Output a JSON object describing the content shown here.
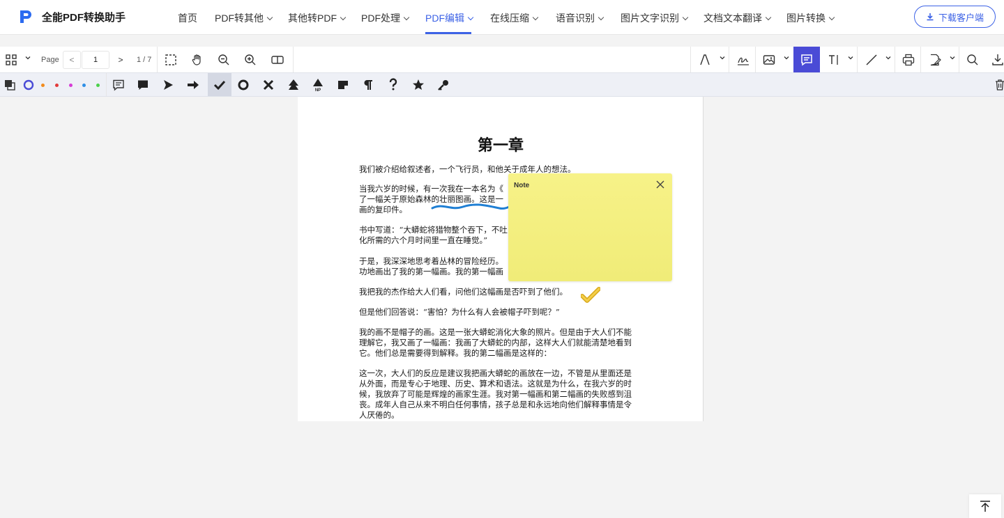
{
  "brand": {
    "name": "全能PDF转换助手"
  },
  "nav": {
    "items": [
      {
        "label": "首页"
      },
      {
        "label": "PDF转其他"
      },
      {
        "label": "其他转PDF"
      },
      {
        "label": "PDF处理"
      },
      {
        "label": "PDF编辑"
      },
      {
        "label": "在线压缩"
      },
      {
        "label": "语音识别"
      },
      {
        "label": "图片文字识别"
      },
      {
        "label": "文档文本翻译"
      },
      {
        "label": "图片转换"
      }
    ],
    "download_label": "下载客户端"
  },
  "toolbar": {
    "page_label": "Page",
    "page_value": "1",
    "page_total": "1 / 7",
    "prev": "<",
    "next": ">"
  },
  "colors": {
    "accent": "#3c62e6",
    "active_tool": "#4a4bd6",
    "note_bg": "#f3ef7e",
    "wave": "#1f7fd4",
    "dots": [
      "#f28b1c",
      "#e23a3a",
      "#d63bd6",
      "#2f8fe6",
      "#4bd14b"
    ]
  },
  "document": {
    "chapter": "第一章",
    "paragraphs": [
      [
        "我们被介绍给叙述者，一个飞行员，和他关于成年人的想法。"
      ],
      [
        "当我六岁的时候，有一次我在一本名为《",
        "了一幅关于原始森林的壮丽图画。这是一",
        "画的复印件。"
      ],
      [
        "书中写道：“大蟒蛇将猎物整个吞下，不吐",
        "化所需的六个月时间里一直在睡觉。”"
      ],
      [
        "于是，我深深地思考着丛林的冒险经历。",
        "功地画出了我的第一幅画。我的第一幅画"
      ],
      [
        "我把我的杰作给大人们看，问他们这幅画是否吓到了他们。"
      ],
      [
        "但是他们回答说：“害怕？为什么有人会被帽子吓到呢？”"
      ],
      [
        "我的画不是帽子的画。这是一张大蟒蛇消化大象的照片。但是由于大人们不能",
        "理解它，我又画了一幅画：我画了大蟒蛇的内部，这样大人们就能清楚地看到",
        "它。他们总是需要得到解释。我的第二幅画是这样的："
      ],
      [
        "这一次，大人们的反应是建议我把画大蟒蛇的画放在一边，不管是从里面还是",
        "从外面，而是专心于地理、历史、算术和语法。这就是为什么，在我六岁的时",
        "候，我放弃了可能是辉煌的画家生涯。我对第一幅画和第二幅画的失败感到沮",
        "丧。成年人自己从来不明白任何事情，孩子总是和永远地向他们解释事情是令",
        "人厌倦的。"
      ]
    ]
  },
  "note": {
    "title": "Note"
  }
}
